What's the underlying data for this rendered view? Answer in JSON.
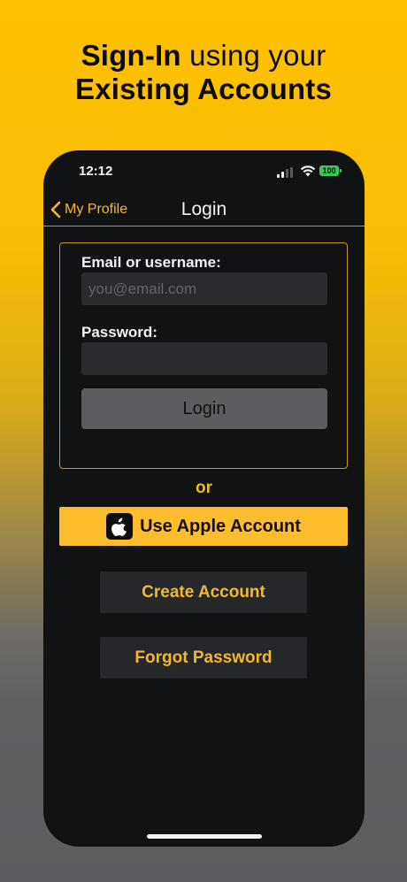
{
  "headline": {
    "line1_bold": "Sign-In",
    "line1_rest": " using your",
    "line2_bold": "Existing Accounts"
  },
  "status_bar": {
    "time": "12:12",
    "battery": "100",
    "icons": [
      "signal-icon",
      "wifi-icon",
      "battery-icon"
    ]
  },
  "navbar": {
    "back_label": "My Profile",
    "title": "Login"
  },
  "login_form": {
    "email_label": "Email or username:",
    "email_value": "",
    "email_placeholder": "you@email.com",
    "password_label": "Password:",
    "password_value": "",
    "password_placeholder": "",
    "submit_label": "Login"
  },
  "divider_text": "or",
  "apple_button": {
    "label": "Use Apple Account",
    "icon": "apple-icon"
  },
  "create_account_label": "Create Account",
  "forgot_password_label": "Forgot Password",
  "colors": {
    "accent": "#f4b92a",
    "apple_button_bg": "#fdbd2c",
    "background_top": "#fdc100",
    "background_bottom": "#5c5d60",
    "phone_bg": "#111214",
    "battery": "#35c759"
  }
}
